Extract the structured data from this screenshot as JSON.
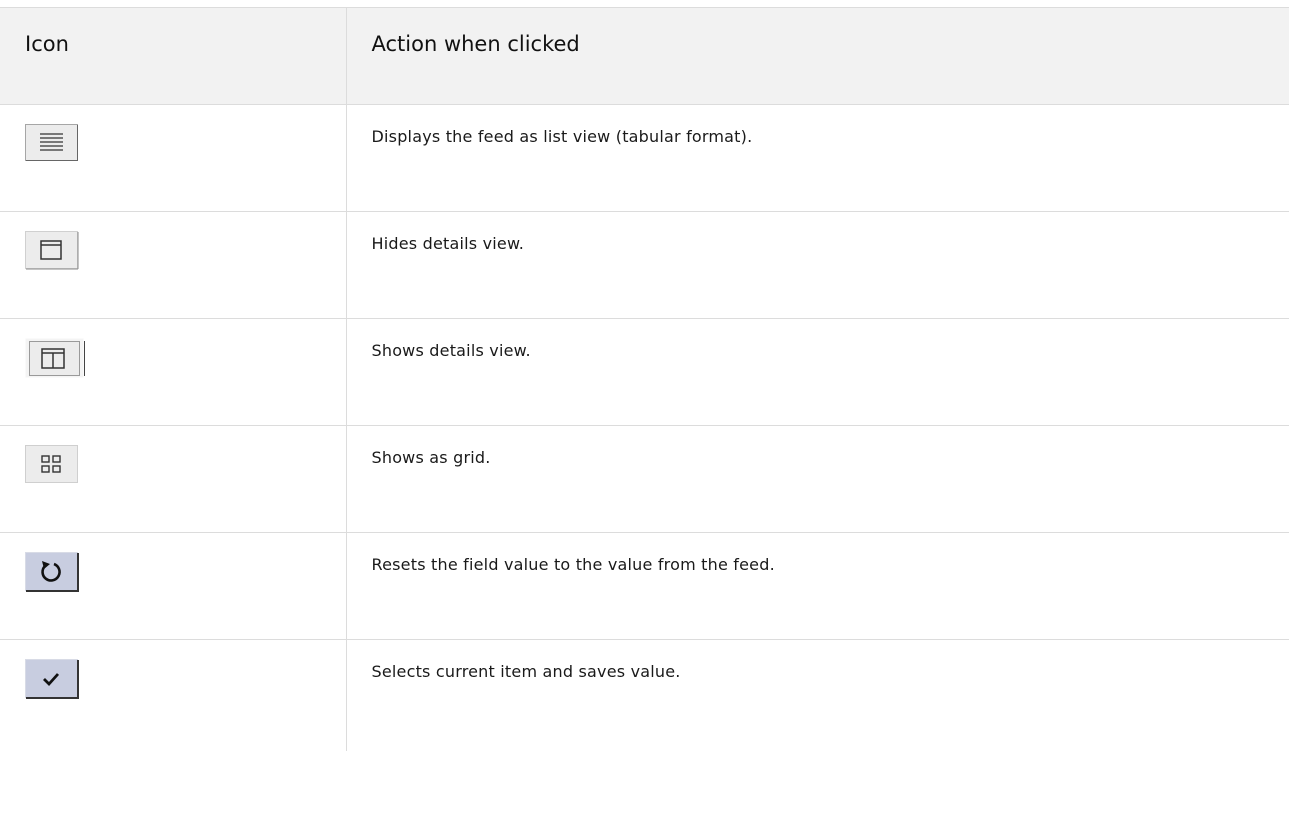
{
  "table": {
    "headers": {
      "icon": "Icon",
      "action": "Action when clicked"
    },
    "rows": [
      {
        "icon": "list-view-icon",
        "action": "Displays the feed as list view (tabular format)."
      },
      {
        "icon": "hide-details-icon",
        "action": "Hides details view."
      },
      {
        "icon": "show-details-icon",
        "action": "Shows details view."
      },
      {
        "icon": "grid-view-icon",
        "action": "Shows as grid."
      },
      {
        "icon": "reset-icon",
        "action": "Resets the field value to the value from the feed."
      },
      {
        "icon": "checkmark-icon",
        "action": "Selects current item and saves value."
      }
    ]
  },
  "colors": {
    "header_bg": "#f2f2f2",
    "border": "#dcdcdc",
    "icon_bg": "#ececec",
    "icon_bg_blue": "#c8cde0"
  }
}
